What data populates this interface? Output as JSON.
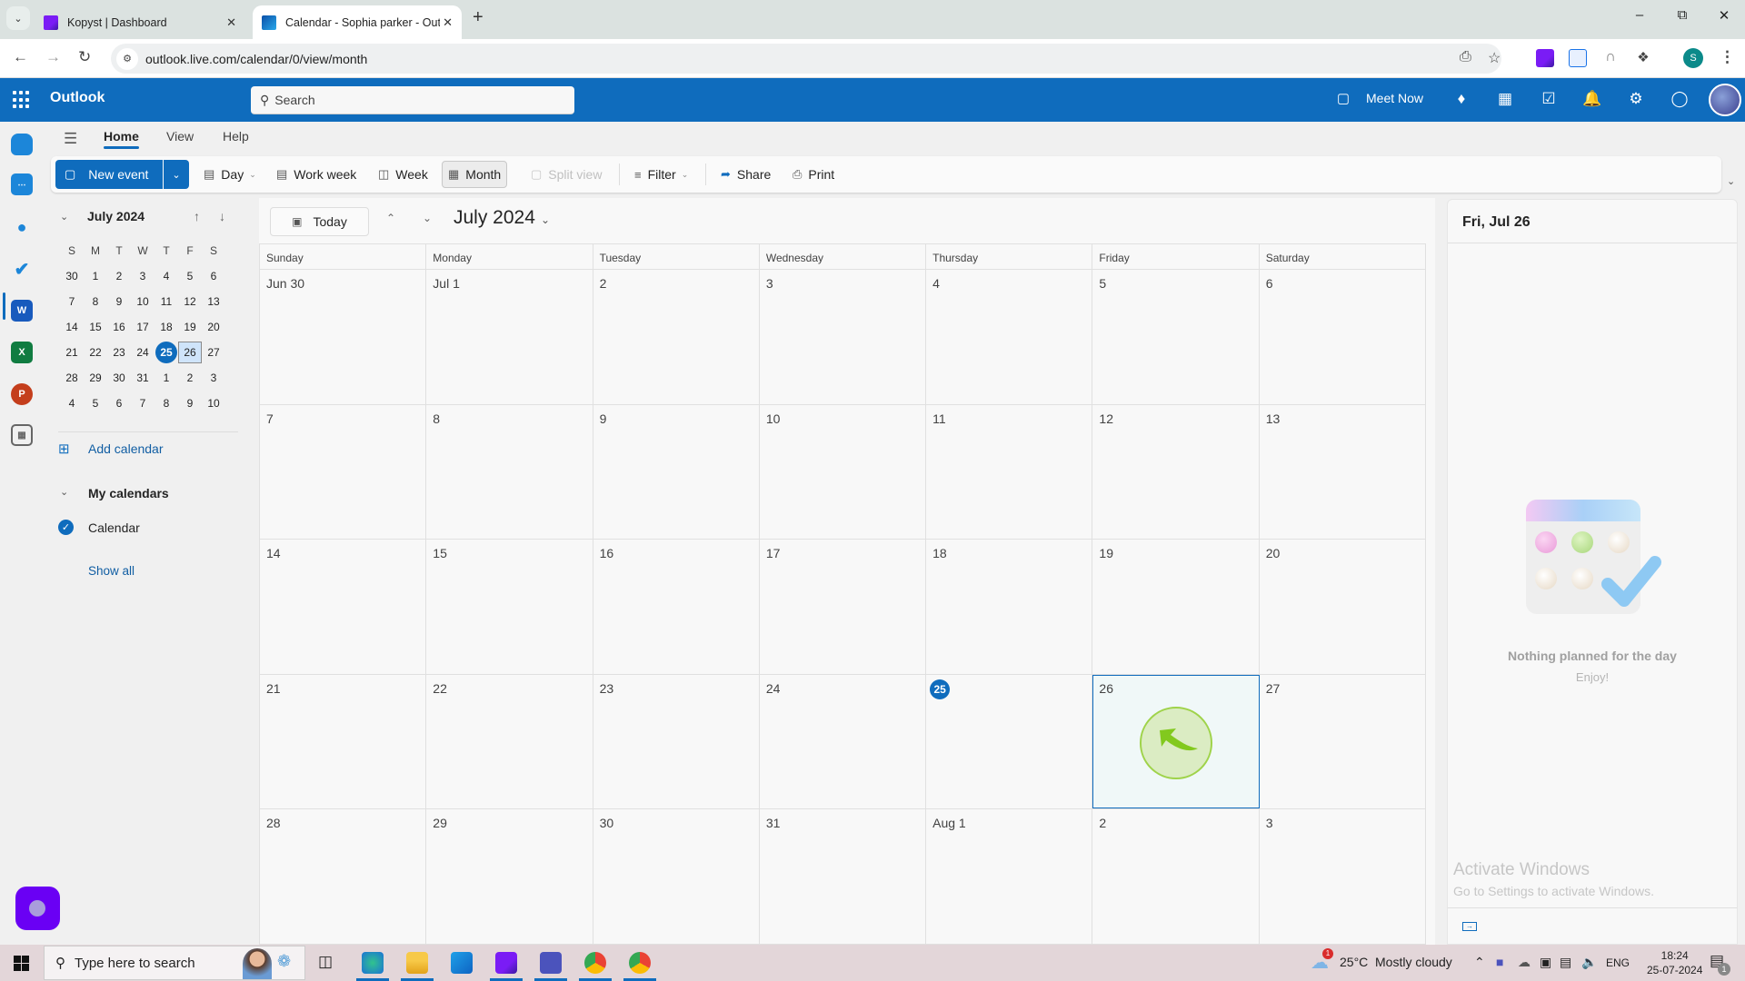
{
  "browser": {
    "tabs": [
      {
        "title": "Kopyst | Dashboard",
        "active": false
      },
      {
        "title": "Calendar - Sophia parker - Outl",
        "active": true
      }
    ],
    "url": "outlook.live.com/calendar/0/view/month",
    "profile_initial": "S"
  },
  "header": {
    "app_name": "Outlook",
    "search_placeholder": "Search",
    "meet_now_label": "Meet Now"
  },
  "menu_tabs": [
    "Home",
    "View",
    "Help"
  ],
  "ribbon": {
    "new_event": "New event",
    "day": "Day",
    "work_week": "Work week",
    "week": "Week",
    "month": "Month",
    "split_view": "Split view",
    "filter": "Filter",
    "share": "Share",
    "print": "Print"
  },
  "mini_calendar": {
    "title": "July 2024",
    "day_headers": [
      "S",
      "M",
      "T",
      "W",
      "T",
      "F",
      "S"
    ],
    "weeks": [
      [
        "30",
        "1",
        "2",
        "3",
        "4",
        "5",
        "6"
      ],
      [
        "7",
        "8",
        "9",
        "10",
        "11",
        "12",
        "13"
      ],
      [
        "14",
        "15",
        "16",
        "17",
        "18",
        "19",
        "20"
      ],
      [
        "21",
        "22",
        "23",
        "24",
        "25",
        "26",
        "27"
      ],
      [
        "28",
        "29",
        "30",
        "31",
        "1",
        "2",
        "3"
      ],
      [
        "4",
        "5",
        "6",
        "7",
        "8",
        "9",
        "10"
      ]
    ],
    "today": "25",
    "selected": "26"
  },
  "left_pane": {
    "add_calendar": "Add calendar",
    "my_calendars": "My calendars",
    "calendars": [
      {
        "name": "Calendar",
        "checked": true,
        "color": "#0f6cbd"
      }
    ],
    "show_all": "Show all"
  },
  "main": {
    "today_button": "Today",
    "month_title": "July 2024",
    "weekday_headers": [
      "Sunday",
      "Monday",
      "Tuesday",
      "Wednesday",
      "Thursday",
      "Friday",
      "Saturday"
    ],
    "weeks": [
      [
        "Jun 30",
        "Jul 1",
        "2",
        "3",
        "4",
        "5",
        "6"
      ],
      [
        "7",
        "8",
        "9",
        "10",
        "11",
        "12",
        "13"
      ],
      [
        "14",
        "15",
        "16",
        "17",
        "18",
        "19",
        "20"
      ],
      [
        "21",
        "22",
        "23",
        "24",
        "25",
        "26",
        "27"
      ],
      [
        "28",
        "29",
        "30",
        "31",
        "Aug 1",
        "2",
        "3"
      ]
    ],
    "today_cell": "25",
    "selected_cell": "26"
  },
  "right_pane": {
    "date_title": "Fri, Jul 26",
    "empty_title": "Nothing planned for the day",
    "empty_subtitle": "Enjoy!"
  },
  "watermark": {
    "title": "Activate Windows",
    "subtitle": "Go to Settings to activate Windows."
  },
  "taskbar": {
    "search_placeholder": "Type here to search",
    "weather_temp": "25°C",
    "weather_text": "Mostly cloudy",
    "weather_badge": "1",
    "language": "ENG",
    "time": "18:24",
    "date": "25-07-2024",
    "notification_count": "1"
  },
  "colors": {
    "brand": "#0f6cbd",
    "copilot": "#6a00f4"
  }
}
